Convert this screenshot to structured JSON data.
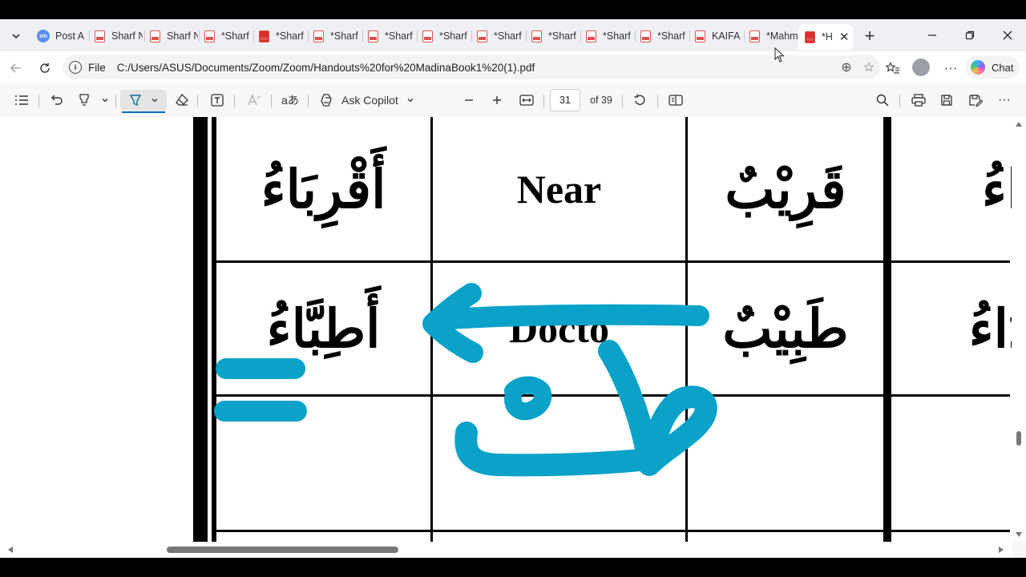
{
  "browser": {
    "tabs": [
      {
        "label": "Post A",
        "icon": "zoom"
      },
      {
        "label": "Sharf N",
        "icon": "pdf"
      },
      {
        "label": "Sharf N",
        "icon": "pdf"
      },
      {
        "label": "*Sharf",
        "icon": "pdf"
      },
      {
        "label": "*Sharf",
        "icon": "pdf-solid"
      },
      {
        "label": "*Sharf",
        "icon": "pdf"
      },
      {
        "label": "*Sharf",
        "icon": "pdf"
      },
      {
        "label": "*Sharf",
        "icon": "pdf"
      },
      {
        "label": "*Sharf",
        "icon": "pdf"
      },
      {
        "label": "*Sharf",
        "icon": "pdf"
      },
      {
        "label": "*Sharf",
        "icon": "pdf"
      },
      {
        "label": "*Sharf",
        "icon": "pdf"
      },
      {
        "label": "KAIFA",
        "icon": "pdf"
      },
      {
        "label": "*Mahm",
        "icon": "pdf"
      }
    ],
    "active_tab": {
      "label": "*H",
      "icon": "pdf-solid"
    },
    "address": {
      "scheme": "File",
      "url": "C:/Users/ASUS/Documents/Zoom/Zoom/Handouts%20for%20MadinaBook1%20(1).pdf"
    },
    "chat_label": "Chat"
  },
  "pdf_toolbar": {
    "ask_copilot": "Ask Copilot",
    "page_current": "31",
    "page_total": "of 39",
    "read_aloud_glyph": "aあ"
  },
  "document": {
    "table_rows": [
      {
        "plural": "أَقْرِبَاءُ",
        "meaning": "Near",
        "singular": "قَرِيْبٌ",
        "partial": "ـرَاءُ"
      },
      {
        "plural": "أَطِبَّاءُ",
        "meaning": "Docto",
        "singular": "طَبِيْبٌ",
        "partial": "ـدَاءُ"
      }
    ],
    "ink_annotation": "طت"
  },
  "colors": {
    "ink": "#0aa2c8",
    "accent": "#0a68c4"
  }
}
